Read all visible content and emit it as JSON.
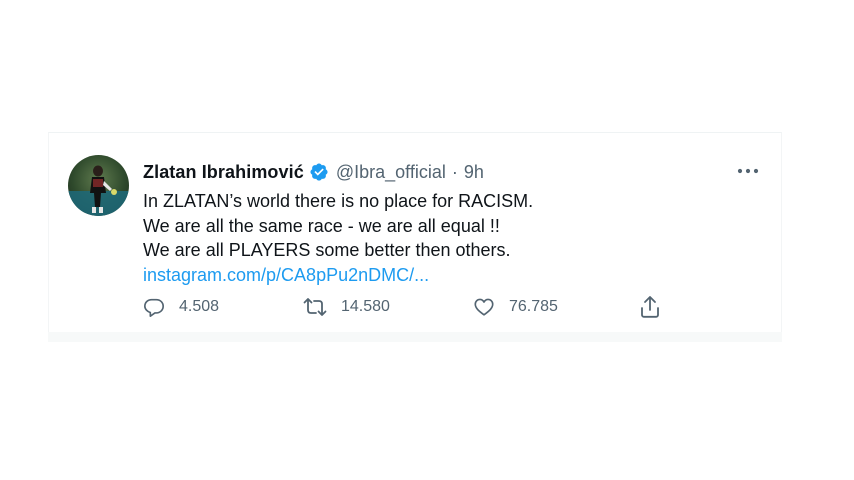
{
  "tweet": {
    "display_name": "Zlatan Ibrahimović",
    "handle": "@Ibra_official",
    "separator": "·",
    "time": "9h",
    "lines": [
      "In ZLATAN’s world there is no place for RACISM.",
      "We are all the same race - we are all equal !!",
      "We are all PLAYERS some better then others."
    ],
    "link": "instagram.com/p/CA8pPu2nDMC/...",
    "more_icon": "more-dots-icon",
    "verified_icon": "verified-badge-icon"
  },
  "actions": {
    "reply_count": "4.508",
    "retweet_count": "14.580",
    "like_count": "76.785",
    "reply_icon": "reply-icon",
    "retweet_icon": "retweet-icon",
    "like_icon": "heart-icon",
    "share_icon": "share-icon"
  },
  "colors": {
    "accent": "#1d9bf0",
    "text": "#0f1419",
    "secondary": "#536471"
  }
}
